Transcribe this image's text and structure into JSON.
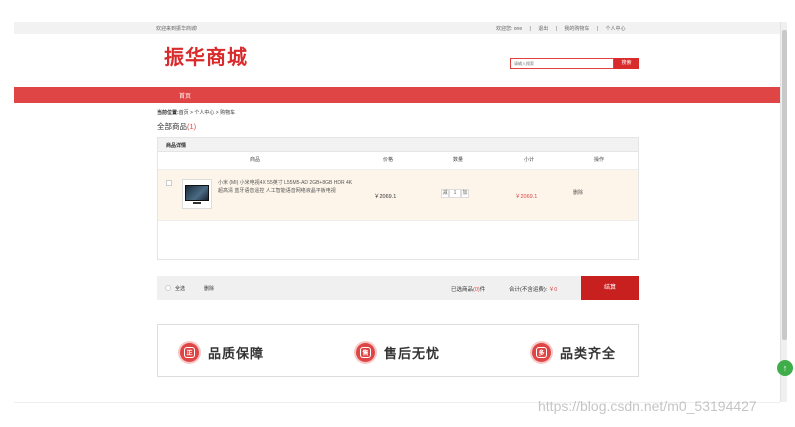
{
  "topbar": {
    "welcome": "欢迎来到振华商城!",
    "user_label": "欢迎您: one",
    "logout": "退出",
    "my_cart": "我的购物车",
    "profile": "个人中心"
  },
  "header": {
    "logo": "振华商城",
    "search_placeholder": "请输入搜索",
    "search_button": "搜索"
  },
  "nav": {
    "home": "首页"
  },
  "breadcrumb": {
    "prefix": "当前位置:",
    "path": "首页 > 个人中心 > 购物车"
  },
  "cart": {
    "all_items_label": "全部商品",
    "all_items_count": "(1)",
    "section_title": "商品详情",
    "columns": {
      "product": "商品",
      "price": "价格",
      "quantity": "数量",
      "subtotal": "小计",
      "action": "操作"
    },
    "items": [
      {
        "name": "小米 (MI) 小米电视4X 55英寸 L55M5-AD 2GB+8GB HDR 4K超高清 蓝牙语音遥控 人工智能语音网络液晶平板电视",
        "price": "￥2069.1",
        "quantity": "1",
        "minus": "减",
        "plus": "加",
        "subtotal": "￥2069.1",
        "delete": "删除"
      }
    ]
  },
  "footer_bar": {
    "select_all": "全选",
    "delete": "删除",
    "selected_prefix": "已选商品",
    "selected_count": "(0)",
    "selected_suffix": "件",
    "total_label": "合计(不含运费): ",
    "total_value": "￥0",
    "checkout": "结算"
  },
  "guarantees": [
    {
      "icon_char": "正",
      "label": "品质保障"
    },
    {
      "icon_char": "售",
      "label": "售后无忧"
    },
    {
      "icon_char": "多",
      "label": "品类齐全"
    }
  ],
  "watermark": "https://blog.csdn.net/m0_53194427",
  "colors": {
    "brand_red": "#e04545",
    "checkout_red": "#c81f1f"
  }
}
